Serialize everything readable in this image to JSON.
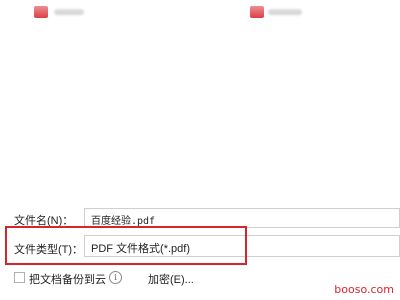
{
  "file_list": {
    "items": [
      {
        "icon": "pdf-file-icon"
      },
      {
        "icon": "pdf-file-icon"
      }
    ]
  },
  "save_form": {
    "filename_label": "文件名(N)：",
    "filename_value": "百度经验.pdf",
    "filetype_label": "文件类型(T)：",
    "filetype_value": "PDF 文件格式(*.pdf)",
    "backup_label": "把文档备份到云",
    "encrypt_label": "加密(E)...",
    "info_glyph": "i"
  },
  "watermark": "booso.com",
  "colors": {
    "highlight": "#d9242c",
    "pdf_icon": "#d8242a"
  }
}
